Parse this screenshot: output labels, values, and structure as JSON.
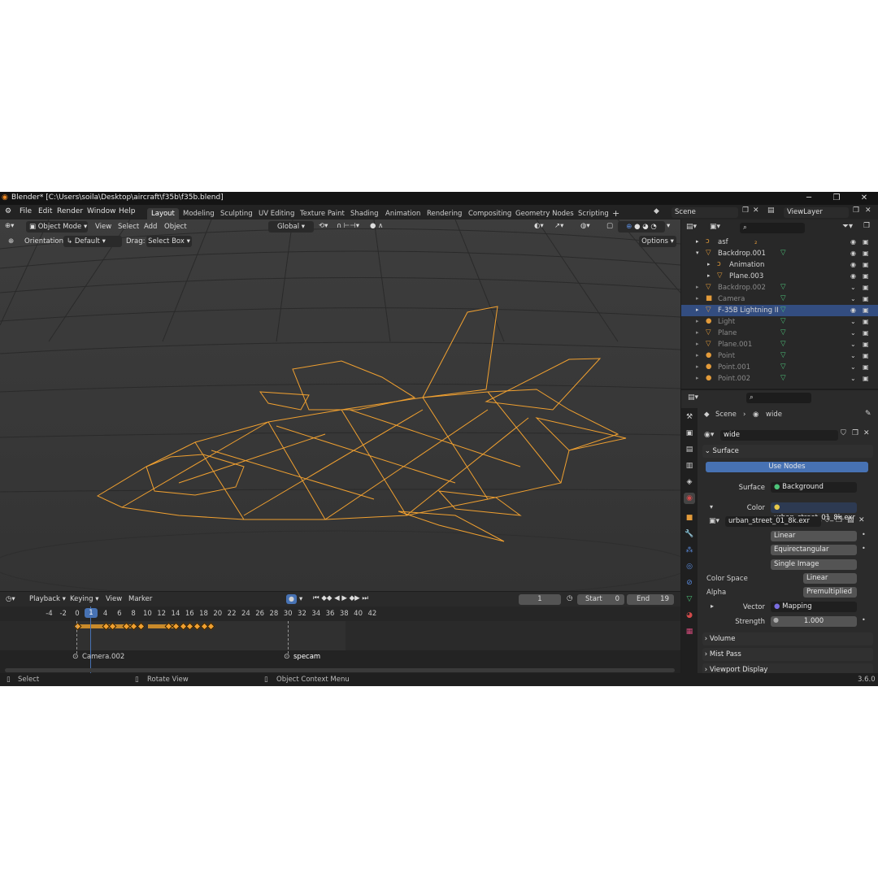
{
  "window": {
    "title": "Blender* [C:\\Users\\soila\\Desktop\\aircraft\\f35b\\f35b.blend]",
    "minimize": "─",
    "maximize": "❐",
    "close": "✕"
  },
  "menu": [
    "File",
    "Edit",
    "Render",
    "Window",
    "Help"
  ],
  "workspaces": [
    "Layout",
    "Modeling",
    "Sculpting",
    "UV Editing",
    "Texture Paint",
    "Shading",
    "Animation",
    "Rendering",
    "Compositing",
    "Geometry Nodes",
    "Scripting"
  ],
  "workspace_add": "+",
  "scene": {
    "label": "Scene",
    "view_layer": "ViewLayer"
  },
  "viewport": {
    "mode": "Object Mode",
    "menus": [
      "View",
      "Select",
      "Add",
      "Object"
    ],
    "transform": "Global",
    "orientation_label": "Orientation:",
    "orientation_value": "Default",
    "drag_label": "Drag:",
    "drag_value": "Select Box",
    "options": "Options"
  },
  "outliner": {
    "rows": [
      {
        "name": "asf",
        "extra": "₂",
        "indent": 1,
        "expand": "▸",
        "icon": "ↄ",
        "state": "normal"
      },
      {
        "name": "Backdrop.001",
        "extra": "",
        "indent": 1,
        "expand": "▾",
        "icon": "▽",
        "state": "normal"
      },
      {
        "name": "Animation",
        "extra": "",
        "indent": 2,
        "expand": "▸",
        "icon": "ↄ",
        "state": "normal"
      },
      {
        "name": "Plane.003",
        "extra": "",
        "indent": 2,
        "expand": "▸",
        "icon": "▽",
        "state": "normal"
      },
      {
        "name": "Backdrop.002",
        "extra": "",
        "indent": 1,
        "expand": "▸",
        "icon": "▽",
        "state": "dim"
      },
      {
        "name": "Camera",
        "extra": "",
        "indent": 1,
        "expand": "▸",
        "icon": "■",
        "state": "dim"
      },
      {
        "name": "F-35B Lightning II",
        "extra": "",
        "indent": 1,
        "expand": "▸",
        "icon": "▽",
        "state": "sel"
      },
      {
        "name": "Light",
        "extra": "",
        "indent": 1,
        "expand": "▸",
        "icon": "●",
        "state": "dim"
      },
      {
        "name": "Plane",
        "extra": "",
        "indent": 1,
        "expand": "▸",
        "icon": "▽",
        "state": "dim"
      },
      {
        "name": "Plane.001",
        "extra": "",
        "indent": 1,
        "expand": "▸",
        "icon": "▽",
        "state": "dim"
      },
      {
        "name": "Point",
        "extra": "",
        "indent": 1,
        "expand": "▸",
        "icon": "●",
        "state": "dim"
      },
      {
        "name": "Point.001",
        "extra": "",
        "indent": 1,
        "expand": "▸",
        "icon": "●",
        "state": "dim"
      },
      {
        "name": "Point.002",
        "extra": "",
        "indent": 1,
        "expand": "▸",
        "icon": "●",
        "state": "dim"
      }
    ]
  },
  "properties": {
    "breadcrumb_scene": "Scene",
    "breadcrumb_world": "wide",
    "world_name": "wide",
    "surface_panel": "Surface",
    "use_nodes": "Use Nodes",
    "surface_label": "Surface",
    "surface_value": "Background",
    "color_label": "Color",
    "color_value": "urban_street_01_8k.exr",
    "image_name": "urban_street_01_8k.exr",
    "interpolation": "Linear",
    "projection": "Equirectangular",
    "source": "Single Image",
    "color_space_label": "Color Space",
    "color_space_value": "Linear",
    "alpha_label": "Alpha",
    "alpha_value": "Premultiplied",
    "vector_label": "Vector",
    "vector_value": "Mapping",
    "strength_label": "Strength",
    "strength_value": "1.000",
    "volume_panel": "Volume",
    "mist_panel": "Mist Pass",
    "display_panel": "Viewport Display"
  },
  "timeline": {
    "menus": [
      "Playback",
      "Keying",
      "View",
      "Marker"
    ],
    "current_frame": "1",
    "start_label": "Start",
    "start_value": "0",
    "end_label": "End",
    "end_value": "19",
    "ticks": [
      "-4",
      "-2",
      "0",
      "1",
      "2",
      "4",
      "6",
      "8",
      "10",
      "12",
      "14",
      "16",
      "18",
      "20",
      "22",
      "24",
      "26",
      "28",
      "30",
      "32",
      "34",
      "36",
      "38",
      "40",
      "42"
    ],
    "markers": [
      "Camera.002",
      "specam"
    ]
  },
  "status": {
    "select": "Select",
    "rotate": "Rotate View",
    "context": "Object Context Menu",
    "version": "3.6.0"
  },
  "colors": {
    "accent_blue": "#4772b3",
    "selection": "#334d80",
    "wire_orange": "#f0a030"
  }
}
